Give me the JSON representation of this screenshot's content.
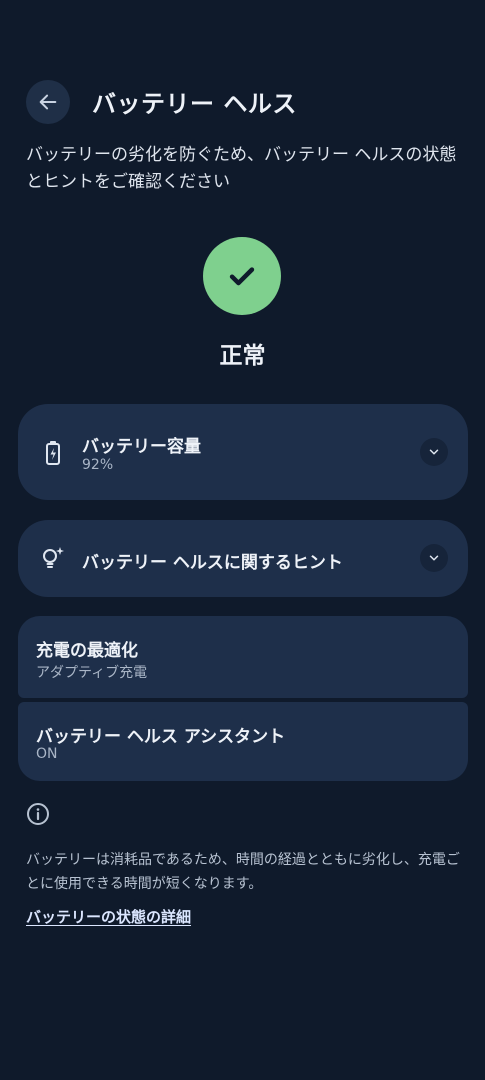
{
  "header": {
    "title": "バッテリー ヘルス",
    "subtitle": "バッテリーの劣化を防ぐため、バッテリー ヘルスの状態とヒントをご確認ください"
  },
  "status": {
    "label": "正常",
    "color": "#7fd08e"
  },
  "cards": {
    "capacity": {
      "title": "バッテリー容量",
      "value": "92%"
    },
    "tips": {
      "title": "バッテリー ヘルスに関するヒント"
    },
    "optimization": {
      "title": "充電の最適化",
      "value": "アダプティブ充電"
    },
    "assistant": {
      "title": "バッテリー ヘルス アシスタント",
      "value": "ON"
    }
  },
  "footer": {
    "note": "バッテリーは消耗品であるため、時間の経過とともに劣化し、充電ごとに使用できる時間が短くなります。",
    "link": "バッテリーの状態の詳細"
  },
  "icons": {
    "back": "back-arrow-icon",
    "status": "checkmark-icon",
    "capacity": "battery-charging-icon",
    "tips": "lightbulb-sparkle-icon",
    "expand": "chevron-down-icon",
    "info": "info-icon"
  }
}
